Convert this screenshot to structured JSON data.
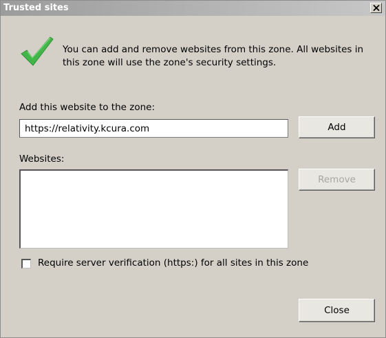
{
  "window": {
    "title": "Trusted sites",
    "close_glyph": "✕"
  },
  "info": {
    "icon": "green-checkmark-icon",
    "text": "You can add and remove websites from this zone. All websites in this zone will use the zone's security settings."
  },
  "add_section": {
    "label": "Add this website to the zone:",
    "input_value": "https://relativity.kcura.com",
    "add_button": "Add"
  },
  "websites_section": {
    "label": "Websites:",
    "items": [],
    "remove_button": "Remove",
    "remove_enabled": false
  },
  "verification": {
    "label": "Require server verification (https:) for all sites in this zone",
    "checked": false
  },
  "footer": {
    "close_button": "Close"
  },
  "colors": {
    "dialog_bg": "#d4d0c8",
    "titlebar_start": "#9c9c9c",
    "check_green": "#43b64a",
    "disabled_text": "#a8a6a0"
  }
}
